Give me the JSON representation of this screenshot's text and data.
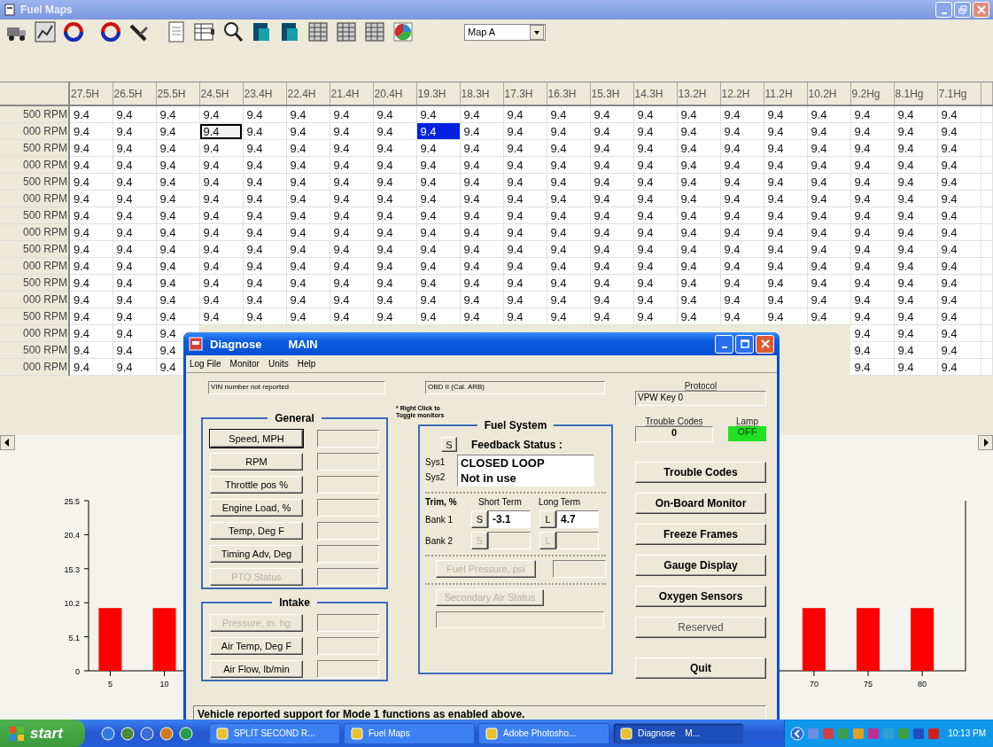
{
  "window": {
    "title": "Fuel Maps"
  },
  "toolbar": {
    "map_select": {
      "value": "Map A"
    }
  },
  "table": {
    "columns": [
      "27.5H",
      "26.5H",
      "25.5H",
      "24.5H",
      "23.4H",
      "22.4H",
      "21.4H",
      "20.4H",
      "19.3H",
      "18.3H",
      "17.3H",
      "16.3H",
      "15.3H",
      "14.3H",
      "13.2H",
      "12.2H",
      "11.2H",
      "10.2H",
      "9.2Hg",
      "8.1Hg",
      "7.1Hg"
    ],
    "rows": [
      {
        "label": "500 RPM",
        "cells": [
          {
            "text": "9.4",
            "selected": false,
            "focused": false
          },
          {
            "text": "9.4",
            "selected": false,
            "focused": false
          },
          {
            "text": "9.4",
            "selected": false,
            "focused": false
          },
          {
            "text": "9.4",
            "selected": false,
            "focused": false
          },
          {
            "text": "9.4",
            "selected": false,
            "focused": false
          },
          {
            "text": "9.4",
            "selected": false,
            "focused": false
          },
          {
            "text": "9.4",
            "selected": false,
            "focused": false
          },
          {
            "text": "9.4",
            "selected": false,
            "focused": false
          },
          {
            "text": "9.4",
            "selected": false,
            "focused": false
          },
          {
            "text": "9.4",
            "selected": false,
            "focused": false
          },
          {
            "text": "9.4",
            "selected": false,
            "focused": false
          },
          {
            "text": "9.4",
            "selected": false,
            "focused": false
          },
          {
            "text": "9.4",
            "selected": false,
            "focused": false
          },
          {
            "text": "9.4",
            "selected": false,
            "focused": false
          },
          {
            "text": "9.4",
            "selected": false,
            "focused": false
          },
          {
            "text": "9.4",
            "selected": false,
            "focused": false
          },
          {
            "text": "9.4",
            "selected": false,
            "focused": false
          },
          {
            "text": "9.4",
            "selected": false,
            "focused": false
          },
          {
            "text": "9.4",
            "selected": false,
            "focused": false
          },
          {
            "text": "9.4",
            "selected": false,
            "focused": false
          },
          {
            "text": "9.4",
            "selected": false,
            "focused": false
          }
        ]
      },
      {
        "label": "000 RPM",
        "cells": [
          {
            "text": "9.4",
            "selected": false,
            "focused": false
          },
          {
            "text": "9.4",
            "selected": false,
            "focused": false
          },
          {
            "text": "9.4",
            "selected": false,
            "focused": false
          },
          {
            "text": "9.4",
            "selected": false,
            "focused": true
          },
          {
            "text": "9.4",
            "selected": false,
            "focused": false
          },
          {
            "text": "9.4",
            "selected": false,
            "focused": false
          },
          {
            "text": "9.4",
            "selected": false,
            "focused": false
          },
          {
            "text": "9.4",
            "selected": false,
            "focused": false
          },
          {
            "text": "9.4",
            "selected": true,
            "focused": false
          },
          {
            "text": "9.4",
            "selected": false,
            "focused": false
          },
          {
            "text": "9.4",
            "selected": false,
            "focused": false
          },
          {
            "text": "9.4",
            "selected": false,
            "focused": false
          },
          {
            "text": "9.4",
            "selected": false,
            "focused": false
          },
          {
            "text": "9.4",
            "selected": false,
            "focused": false
          },
          {
            "text": "9.4",
            "selected": false,
            "focused": false
          },
          {
            "text": "9.4",
            "selected": false,
            "focused": false
          },
          {
            "text": "9.4",
            "selected": false,
            "focused": false
          },
          {
            "text": "9.4",
            "selected": false,
            "focused": false
          },
          {
            "text": "9.4",
            "selected": false,
            "focused": false
          },
          {
            "text": "9.4",
            "selected": false,
            "focused": false
          },
          {
            "text": "9.4",
            "selected": false,
            "focused": false
          }
        ]
      },
      {
        "label": "500 RPM",
        "cells": [
          {
            "text": "9.4",
            "selected": false,
            "focused": false
          },
          {
            "text": "9.4",
            "selected": false,
            "focused": false
          },
          {
            "text": "9.4",
            "selected": false,
            "focused": false
          },
          {
            "text": "9.4",
            "selected": false,
            "focused": false
          },
          {
            "text": "9.4",
            "selected": false,
            "focused": false
          },
          {
            "text": "9.4",
            "selected": false,
            "focused": false
          },
          {
            "text": "9.4",
            "selected": false,
            "focused": false
          },
          {
            "text": "9.4",
            "selected": false,
            "focused": false
          },
          {
            "text": "9.4",
            "selected": false,
            "focused": false
          },
          {
            "text": "9.4",
            "selected": false,
            "focused": false
          },
          {
            "text": "9.4",
            "selected": false,
            "focused": false
          },
          {
            "text": "9.4",
            "selected": false,
            "focused": false
          },
          {
            "text": "9.4",
            "selected": false,
            "focused": false
          },
          {
            "text": "9.4",
            "selected": false,
            "focused": false
          },
          {
            "text": "9.4",
            "selected": false,
            "focused": false
          },
          {
            "text": "9.4",
            "selected": false,
            "focused": false
          },
          {
            "text": "9.4",
            "selected": false,
            "focused": false
          },
          {
            "text": "9.4",
            "selected": false,
            "focused": false
          },
          {
            "text": "9.4",
            "selected": false,
            "focused": false
          },
          {
            "text": "9.4",
            "selected": false,
            "focused": false
          },
          {
            "text": "9.4",
            "selected": false,
            "focused": false
          }
        ]
      },
      {
        "label": "000 RPM",
        "cells": [
          {
            "text": "9.4",
            "selected": false,
            "focused": false
          },
          {
            "text": "9.4",
            "selected": false,
            "focused": false
          },
          {
            "text": "9.4",
            "selected": false,
            "focused": false
          },
          {
            "text": "9.4",
            "selected": false,
            "focused": false
          },
          {
            "text": "9.4",
            "selected": false,
            "focused": false
          },
          {
            "text": "9.4",
            "selected": false,
            "focused": false
          },
          {
            "text": "9.4",
            "selected": false,
            "focused": false
          },
          {
            "text": "9.4",
            "selected": false,
            "focused": false
          },
          {
            "text": "9.4",
            "selected": false,
            "focused": false
          },
          {
            "text": "9.4",
            "selected": false,
            "focused": false
          },
          {
            "text": "9.4",
            "selected": false,
            "focused": false
          },
          {
            "text": "9.4",
            "selected": false,
            "focused": false
          },
          {
            "text": "9.4",
            "selected": false,
            "focused": false
          },
          {
            "text": "9.4",
            "selected": false,
            "focused": false
          },
          {
            "text": "9.4",
            "selected": false,
            "focused": false
          },
          {
            "text": "9.4",
            "selected": false,
            "focused": false
          },
          {
            "text": "9.4",
            "selected": false,
            "focused": false
          },
          {
            "text": "9.4",
            "selected": false,
            "focused": false
          },
          {
            "text": "9.4",
            "selected": false,
            "focused": false
          },
          {
            "text": "9.4",
            "selected": false,
            "focused": false
          },
          {
            "text": "9.4",
            "selected": false,
            "focused": false
          }
        ]
      },
      {
        "label": "500 RPM",
        "cells": [
          {
            "text": "9.4",
            "selected": false,
            "focused": false
          },
          {
            "text": "9.4",
            "selected": false,
            "focused": false
          },
          {
            "text": "9.4",
            "selected": false,
            "focused": false
          },
          {
            "text": "9.4",
            "selected": false,
            "focused": false
          },
          {
            "text": "9.4",
            "selected": false,
            "focused": false
          },
          {
            "text": "9.4",
            "selected": false,
            "focused": false
          },
          {
            "text": "9.4",
            "selected": false,
            "focused": false
          },
          {
            "text": "9.4",
            "selected": false,
            "focused": false
          },
          {
            "text": "9.4",
            "selected": false,
            "focused": false
          },
          {
            "text": "9.4",
            "selected": false,
            "focused": false
          },
          {
            "text": "9.4",
            "selected": false,
            "focused": false
          },
          {
            "text": "9.4",
            "selected": false,
            "focused": false
          },
          {
            "text": "9.4",
            "selected": false,
            "focused": false
          },
          {
            "text": "9.4",
            "selected": false,
            "focused": false
          },
          {
            "text": "9.4",
            "selected": false,
            "focused": false
          },
          {
            "text": "9.4",
            "selected": false,
            "focused": false
          },
          {
            "text": "9.4",
            "selected": false,
            "focused": false
          },
          {
            "text": "9.4",
            "selected": false,
            "focused": false
          },
          {
            "text": "9.4",
            "selected": false,
            "focused": false
          },
          {
            "text": "9.4",
            "selected": false,
            "focused": false
          },
          {
            "text": "9.4",
            "selected": false,
            "focused": false
          }
        ]
      },
      {
        "label": "000 RPM",
        "cells": [
          {
            "text": "9.4",
            "selected": false,
            "focused": false
          },
          {
            "text": "9.4",
            "selected": false,
            "focused": false
          },
          {
            "text": "9.4",
            "selected": false,
            "focused": false
          },
          {
            "text": "9.4",
            "selected": false,
            "focused": false
          },
          {
            "text": "9.4",
            "selected": false,
            "focused": false
          },
          {
            "text": "9.4",
            "selected": false,
            "focused": false
          },
          {
            "text": "9.4",
            "selected": false,
            "focused": false
          },
          {
            "text": "9.4",
            "selected": false,
            "focused": false
          },
          {
            "text": "9.4",
            "selected": false,
            "focused": false
          },
          {
            "text": "9.4",
            "selected": false,
            "focused": false
          },
          {
            "text": "9.4",
            "selected": false,
            "focused": false
          },
          {
            "text": "9.4",
            "selected": false,
            "focused": false
          },
          {
            "text": "9.4",
            "selected": false,
            "focused": false
          },
          {
            "text": "9.4",
            "selected": false,
            "focused": false
          },
          {
            "text": "9.4",
            "selected": false,
            "focused": false
          },
          {
            "text": "9.4",
            "selected": false,
            "focused": false
          },
          {
            "text": "9.4",
            "selected": false,
            "focused": false
          },
          {
            "text": "9.4",
            "selected": false,
            "focused": false
          },
          {
            "text": "9.4",
            "selected": false,
            "focused": false
          },
          {
            "text": "9.4",
            "selected": false,
            "focused": false
          },
          {
            "text": "9.4",
            "selected": false,
            "focused": false
          }
        ]
      },
      {
        "label": "500 RPM",
        "cells": [
          {
            "text": "9.4",
            "selected": false,
            "focused": false
          },
          {
            "text": "9.4",
            "selected": false,
            "focused": false
          },
          {
            "text": "9.4",
            "selected": false,
            "focused": false
          },
          {
            "text": "9.4",
            "selected": false,
            "focused": false
          },
          {
            "text": "9.4",
            "selected": false,
            "focused": false
          },
          {
            "text": "9.4",
            "selected": false,
            "focused": false
          },
          {
            "text": "9.4",
            "selected": false,
            "focused": false
          },
          {
            "text": "9.4",
            "selected": false,
            "focused": false
          },
          {
            "text": "9.4",
            "selected": false,
            "focused": false
          },
          {
            "text": "9.4",
            "selected": false,
            "focused": false
          },
          {
            "text": "9.4",
            "selected": false,
            "focused": false
          },
          {
            "text": "9.4",
            "selected": false,
            "focused": false
          },
          {
            "text": "9.4",
            "selected": false,
            "focused": false
          },
          {
            "text": "9.4",
            "selected": false,
            "focused": false
          },
          {
            "text": "9.4",
            "selected": false,
            "focused": false
          },
          {
            "text": "9.4",
            "selected": false,
            "focused": false
          },
          {
            "text": "9.4",
            "selected": false,
            "focused": false
          },
          {
            "text": "9.4",
            "selected": false,
            "focused": false
          },
          {
            "text": "9.4",
            "selected": false,
            "focused": false
          },
          {
            "text": "9.4",
            "selected": false,
            "focused": false
          },
          {
            "text": "9.4",
            "selected": false,
            "focused": false
          }
        ]
      },
      {
        "label": "000 RPM",
        "cells": [
          {
            "text": "9.4",
            "selected": false,
            "focused": false
          },
          {
            "text": "9.4",
            "selected": false,
            "focused": false
          },
          {
            "text": "9.4",
            "selected": false,
            "focused": false
          },
          {
            "text": "9.4",
            "selected": false,
            "focused": false
          },
          {
            "text": "9.4",
            "selected": false,
            "focused": false
          },
          {
            "text": "9.4",
            "selected": false,
            "focused": false
          },
          {
            "text": "9.4",
            "selected": false,
            "focused": false
          },
          {
            "text": "9.4",
            "selected": false,
            "focused": false
          },
          {
            "text": "9.4",
            "selected": false,
            "focused": false
          },
          {
            "text": "9.4",
            "selected": false,
            "focused": false
          },
          {
            "text": "9.4",
            "selected": false,
            "focused": false
          },
          {
            "text": "9.4",
            "selected": false,
            "focused": false
          },
          {
            "text": "9.4",
            "selected": false,
            "focused": false
          },
          {
            "text": "9.4",
            "selected": false,
            "focused": false
          },
          {
            "text": "9.4",
            "selected": false,
            "focused": false
          },
          {
            "text": "9.4",
            "selected": false,
            "focused": false
          },
          {
            "text": "9.4",
            "selected": false,
            "focused": false
          },
          {
            "text": "9.4",
            "selected": false,
            "focused": false
          },
          {
            "text": "9.4",
            "selected": false,
            "focused": false
          },
          {
            "text": "9.4",
            "selected": false,
            "focused": false
          },
          {
            "text": "9.4",
            "selected": false,
            "focused": false
          }
        ]
      },
      {
        "label": "500 RPM",
        "cells": [
          {
            "text": "9.4",
            "selected": false,
            "focused": false
          },
          {
            "text": "9.4",
            "selected": false,
            "focused": false
          },
          {
            "text": "9.4",
            "selected": false,
            "focused": false
          },
          {
            "text": "9.4",
            "selected": false,
            "focused": false
          },
          {
            "text": "9.4",
            "selected": false,
            "focused": false
          },
          {
            "text": "9.4",
            "selected": false,
            "focused": false
          },
          {
            "text": "9.4",
            "selected": false,
            "focused": false
          },
          {
            "text": "9.4",
            "selected": false,
            "focused": false
          },
          {
            "text": "9.4",
            "selected": false,
            "focused": false
          },
          {
            "text": "9.4",
            "selected": false,
            "focused": false
          },
          {
            "text": "9.4",
            "selected": false,
            "focused": false
          },
          {
            "text": "9.4",
            "selected": false,
            "focused": false
          },
          {
            "text": "9.4",
            "selected": false,
            "focused": false
          },
          {
            "text": "9.4",
            "selected": false,
            "focused": false
          },
          {
            "text": "9.4",
            "selected": false,
            "focused": false
          },
          {
            "text": "9.4",
            "selected": false,
            "focused": false
          },
          {
            "text": "9.4",
            "selected": false,
            "focused": false
          },
          {
            "text": "9.4",
            "selected": false,
            "focused": false
          },
          {
            "text": "9.4",
            "selected": false,
            "focused": false
          },
          {
            "text": "9.4",
            "selected": false,
            "focused": false
          },
          {
            "text": "9.4",
            "selected": false,
            "focused": false
          }
        ]
      },
      {
        "label": "000 RPM",
        "cells": [
          {
            "text": "9.4",
            "selected": false,
            "focused": false
          },
          {
            "text": "9.4",
            "selected": false,
            "focused": false
          },
          {
            "text": "9.4",
            "selected": false,
            "focused": false
          },
          {
            "text": "9.4",
            "selected": false,
            "focused": false
          },
          {
            "text": "9.4",
            "selected": false,
            "focused": false
          },
          {
            "text": "9.4",
            "selected": false,
            "focused": false
          },
          {
            "text": "9.4",
            "selected": false,
            "focused": false
          },
          {
            "text": "9.4",
            "selected": false,
            "focused": false
          },
          {
            "text": "9.4",
            "selected": false,
            "focused": false
          },
          {
            "text": "9.4",
            "selected": false,
            "focused": false
          },
          {
            "text": "9.4",
            "selected": false,
            "focused": false
          },
          {
            "text": "9.4",
            "selected": false,
            "focused": false
          },
          {
            "text": "9.4",
            "selected": false,
            "focused": false
          },
          {
            "text": "9.4",
            "selected": false,
            "focused": false
          },
          {
            "text": "9.4",
            "selected": false,
            "focused": false
          },
          {
            "text": "9.4",
            "selected": false,
            "focused": false
          },
          {
            "text": "9.4",
            "selected": false,
            "focused": false
          },
          {
            "text": "9.4",
            "selected": false,
            "focused": false
          },
          {
            "text": "9.4",
            "selected": false,
            "focused": false
          },
          {
            "text": "9.4",
            "selected": false,
            "focused": false
          },
          {
            "text": "9.4",
            "selected": false,
            "focused": false
          }
        ]
      },
      {
        "label": "500 RPM",
        "cells": [
          {
            "text": "9.4",
            "selected": false,
            "focused": false
          },
          {
            "text": "9.4",
            "selected": false,
            "focused": false
          },
          {
            "text": "9.4",
            "selected": false,
            "focused": false
          },
          {
            "text": "9.4",
            "selected": false,
            "focused": false
          },
          {
            "text": "9.4",
            "selected": false,
            "focused": false
          },
          {
            "text": "9.4",
            "selected": false,
            "focused": false
          },
          {
            "text": "9.4",
            "selected": false,
            "focused": false
          },
          {
            "text": "9.4",
            "selected": false,
            "focused": false
          },
          {
            "text": "9.4",
            "selected": false,
            "focused": false
          },
          {
            "text": "9.4",
            "selected": false,
            "focused": false
          },
          {
            "text": "9.4",
            "selected": false,
            "focused": false
          },
          {
            "text": "9.4",
            "selected": false,
            "focused": false
          },
          {
            "text": "9.4",
            "selected": false,
            "focused": false
          },
          {
            "text": "9.4",
            "selected": false,
            "focused": false
          },
          {
            "text": "9.4",
            "selected": false,
            "focused": false
          },
          {
            "text": "9.4",
            "selected": false,
            "focused": false
          },
          {
            "text": "9.4",
            "selected": false,
            "focused": false
          },
          {
            "text": "9.4",
            "selected": false,
            "focused": false
          },
          {
            "text": "9.4",
            "selected": false,
            "focused": false
          },
          {
            "text": "9.4",
            "selected": false,
            "focused": false
          },
          {
            "text": "9.4",
            "selected": false,
            "focused": false
          }
        ]
      },
      {
        "label": "000 RPM",
        "cells": [
          {
            "text": "9.4",
            "selected": false,
            "focused": false
          },
          {
            "text": "9.4",
            "selected": false,
            "focused": false
          },
          {
            "text": "9.4",
            "selected": false,
            "focused": false
          },
          {
            "text": "9.4",
            "selected": false,
            "focused": false
          },
          {
            "text": "9.4",
            "selected": false,
            "focused": false
          },
          {
            "text": "9.4",
            "selected": false,
            "focused": false
          },
          {
            "text": "9.4",
            "selected": false,
            "focused": false
          },
          {
            "text": "9.4",
            "selected": false,
            "focused": false
          },
          {
            "text": "9.4",
            "selected": false,
            "focused": false
          },
          {
            "text": "9.4",
            "selected": false,
            "focused": false
          },
          {
            "text": "9.4",
            "selected": false,
            "focused": false
          },
          {
            "text": "9.4",
            "selected": false,
            "focused": false
          },
          {
            "text": "9.4",
            "selected": false,
            "focused": false
          },
          {
            "text": "9.4",
            "selected": false,
            "focused": false
          },
          {
            "text": "9.4",
            "selected": false,
            "focused": false
          },
          {
            "text": "9.4",
            "selected": false,
            "focused": false
          },
          {
            "text": "9.4",
            "selected": false,
            "focused": false
          },
          {
            "text": "9.4",
            "selected": false,
            "focused": false
          },
          {
            "text": "9.4",
            "selected": false,
            "focused": false
          },
          {
            "text": "9.4",
            "selected": false,
            "focused": false
          },
          {
            "text": "9.4",
            "selected": false,
            "focused": false
          }
        ]
      },
      {
        "label": "500 RPM",
        "cells": [
          {
            "text": "9.4",
            "selected": false,
            "focused": false
          },
          {
            "text": "9.4",
            "selected": false,
            "focused": false
          },
          {
            "text": "9.4",
            "selected": false,
            "focused": false
          },
          {
            "text": "9.4",
            "selected": false,
            "focused": false
          },
          {
            "text": "9.4",
            "selected": false,
            "focused": false
          },
          {
            "text": "9.4",
            "selected": false,
            "focused": false
          },
          {
            "text": "9.4",
            "selected": false,
            "focused": false
          },
          {
            "text": "9.4",
            "selected": false,
            "focused": false
          },
          {
            "text": "9.4",
            "selected": false,
            "focused": false
          },
          {
            "text": "9.4",
            "selected": false,
            "focused": false
          },
          {
            "text": "9.4",
            "selected": false,
            "focused": false
          },
          {
            "text": "9.4",
            "selected": false,
            "focused": false
          },
          {
            "text": "9.4",
            "selected": false,
            "focused": false
          },
          {
            "text": "9.4",
            "selected": false,
            "focused": false
          },
          {
            "text": "9.4",
            "selected": false,
            "focused": false
          },
          {
            "text": "9.4",
            "selected": false,
            "focused": false
          },
          {
            "text": "9.4",
            "selected": false,
            "focused": false
          },
          {
            "text": "9.4",
            "selected": false,
            "focused": false
          },
          {
            "text": "9.4",
            "selected": false,
            "focused": false
          },
          {
            "text": "9.4",
            "selected": false,
            "focused": false
          },
          {
            "text": "9.4",
            "selected": false,
            "focused": false
          }
        ]
      },
      {
        "label": "000 RPM",
        "cells": [
          {
            "text": "9.4",
            "selected": false,
            "focused": false
          },
          {
            "text": "9.4",
            "selected": false,
            "focused": false
          },
          {
            "text": "9.4",
            "selected": false,
            "focused": false
          },
          null,
          null,
          null,
          null,
          null,
          null,
          null,
          null,
          null,
          null,
          null,
          null,
          null,
          null,
          null,
          {
            "text": "9.4",
            "selected": false,
            "focused": false
          },
          {
            "text": "9.4",
            "selected": false,
            "focused": false
          },
          {
            "text": "9.4",
            "selected": false,
            "focused": false
          }
        ]
      },
      {
        "label": "500 RPM",
        "cells": [
          {
            "text": "9.4",
            "selected": false,
            "focused": false
          },
          {
            "text": "9.4",
            "selected": false,
            "focused": false
          },
          {
            "text": "9.4",
            "selected": false,
            "focused": false
          },
          null,
          null,
          null,
          null,
          null,
          null,
          null,
          null,
          null,
          null,
          null,
          null,
          null,
          null,
          null,
          {
            "text": "9.4",
            "selected": false,
            "focused": false
          },
          {
            "text": "9.4",
            "selected": false,
            "focused": false
          },
          {
            "text": "9.4",
            "selected": false,
            "focused": false
          }
        ]
      },
      {
        "label": "000 RPM",
        "cells": [
          {
            "text": "9.4",
            "selected": false,
            "focused": false
          },
          {
            "text": "9.4",
            "selected": false,
            "focused": false
          },
          {
            "text": "9.4",
            "selected": false,
            "focused": false
          },
          null,
          null,
          null,
          null,
          null,
          null,
          null,
          null,
          null,
          null,
          null,
          null,
          null,
          null,
          null,
          {
            "text": "9.4",
            "selected": false,
            "focused": false
          },
          {
            "text": "9.4",
            "selected": false,
            "focused": false
          },
          {
            "text": "9.4",
            "selected": false,
            "focused": false
          }
        ]
      }
    ]
  },
  "chart": {
    "chart_data": {
      "type": "bar",
      "x": [
        5,
        10,
        70,
        75,
        80
      ],
      "values": [
        9.4,
        9.4,
        9.4,
        9.4,
        9.4
      ],
      "xlim": [
        3,
        84
      ],
      "xticks": [
        5,
        10,
        70,
        75,
        80
      ],
      "ylim": [
        0,
        25.5
      ],
      "yticks": [
        0,
        5.1,
        10.2,
        15.3,
        20.4,
        25.5
      ]
    }
  },
  "dialog": {
    "title": "Diagnose",
    "subtitle": "MAIN",
    "menu": [
      "Log File",
      "Monitor",
      "Units",
      "Help"
    ],
    "vin": "VIN number not reported",
    "standard": "OBD II (Cal. ARB)",
    "note": "* Right Click to Toggle monitors",
    "protocol": {
      "label": "Protocol",
      "value": "VPW Key 0"
    },
    "trouble_codes": {
      "label": "Trouble Codes",
      "value": "0"
    },
    "lamp": {
      "label": "Lamp",
      "value": "OFF",
      "on": false
    },
    "groups": [
      {
        "title": "General",
        "monitors": [
          {
            "label": "Speed, MPH",
            "disabled": false,
            "default": true
          },
          {
            "label": "RPM",
            "disabled": false,
            "default": false
          },
          {
            "label": "Throttle pos %",
            "disabled": false,
            "default": false
          },
          {
            "label": "Engine Load, %",
            "disabled": false,
            "default": false
          },
          {
            "label": "Temp, Deg F",
            "disabled": false,
            "default": false
          },
          {
            "label": "Timing Adv, Deg",
            "disabled": false,
            "default": false
          },
          {
            "label": "PTO Status",
            "disabled": true,
            "default": false
          }
        ]
      },
      {
        "title": "Intake",
        "monitors": [
          {
            "label": "Pressure, in. hg",
            "disabled": true,
            "default": false
          },
          {
            "label": "Air Temp, Deg F",
            "disabled": false,
            "default": false
          },
          {
            "label": "Air Flow,  lb/min",
            "disabled": false,
            "default": false
          }
        ]
      }
    ],
    "fuel_system": {
      "title": "Fuel System",
      "status_button": "S",
      "feedback_label": "Feedback Status :",
      "systems": [
        {
          "label": "Sys1",
          "status": "CLOSED LOOP"
        },
        {
          "label": "Sys2",
          "status": "Not in use"
        }
      ],
      "trim_label": "Trim, %",
      "short_term_label": "Short Term",
      "long_term_label": "Long Term",
      "banks": [
        {
          "label": "Bank 1",
          "short_button": "S",
          "short_value": "-3.1",
          "long_button": "L",
          "long_value": "4.7",
          "disabled": false
        },
        {
          "label": "Bank 2",
          "short_button": "S",
          "long_button": "L",
          "disabled": true
        }
      ],
      "fuel_pressure": {
        "label": "Fuel Pressure, psi",
        "disabled": true
      },
      "secondary_air": {
        "label": "Secondary Air Status",
        "disabled": true
      }
    },
    "actions": [
      {
        "label": "Trouble Codes",
        "disabled": false
      },
      {
        "label": "On-Board Monitor",
        "disabled": false
      },
      {
        "label": "Freeze Frames",
        "disabled": false
      },
      {
        "label": "Gauge Display",
        "disabled": false
      },
      {
        "label": "Oxygen Sensors",
        "disabled": false
      },
      {
        "label": "Reserved",
        "disabled": true
      },
      {
        "label": "Quit",
        "disabled": false
      }
    ],
    "status": "Vehicle reported support for Mode 1 functions as enabled above."
  },
  "taskbar": {
    "start": "start",
    "tasks": [
      {
        "label": "SPLIT SECOND R...",
        "selected": false
      },
      {
        "label": "Fuel Maps",
        "selected": false
      },
      {
        "label": "Adobe Photosho...",
        "selected": false
      },
      {
        "label": "Diagnose    M...",
        "selected": true
      }
    ],
    "clock": "10:13 PM"
  }
}
